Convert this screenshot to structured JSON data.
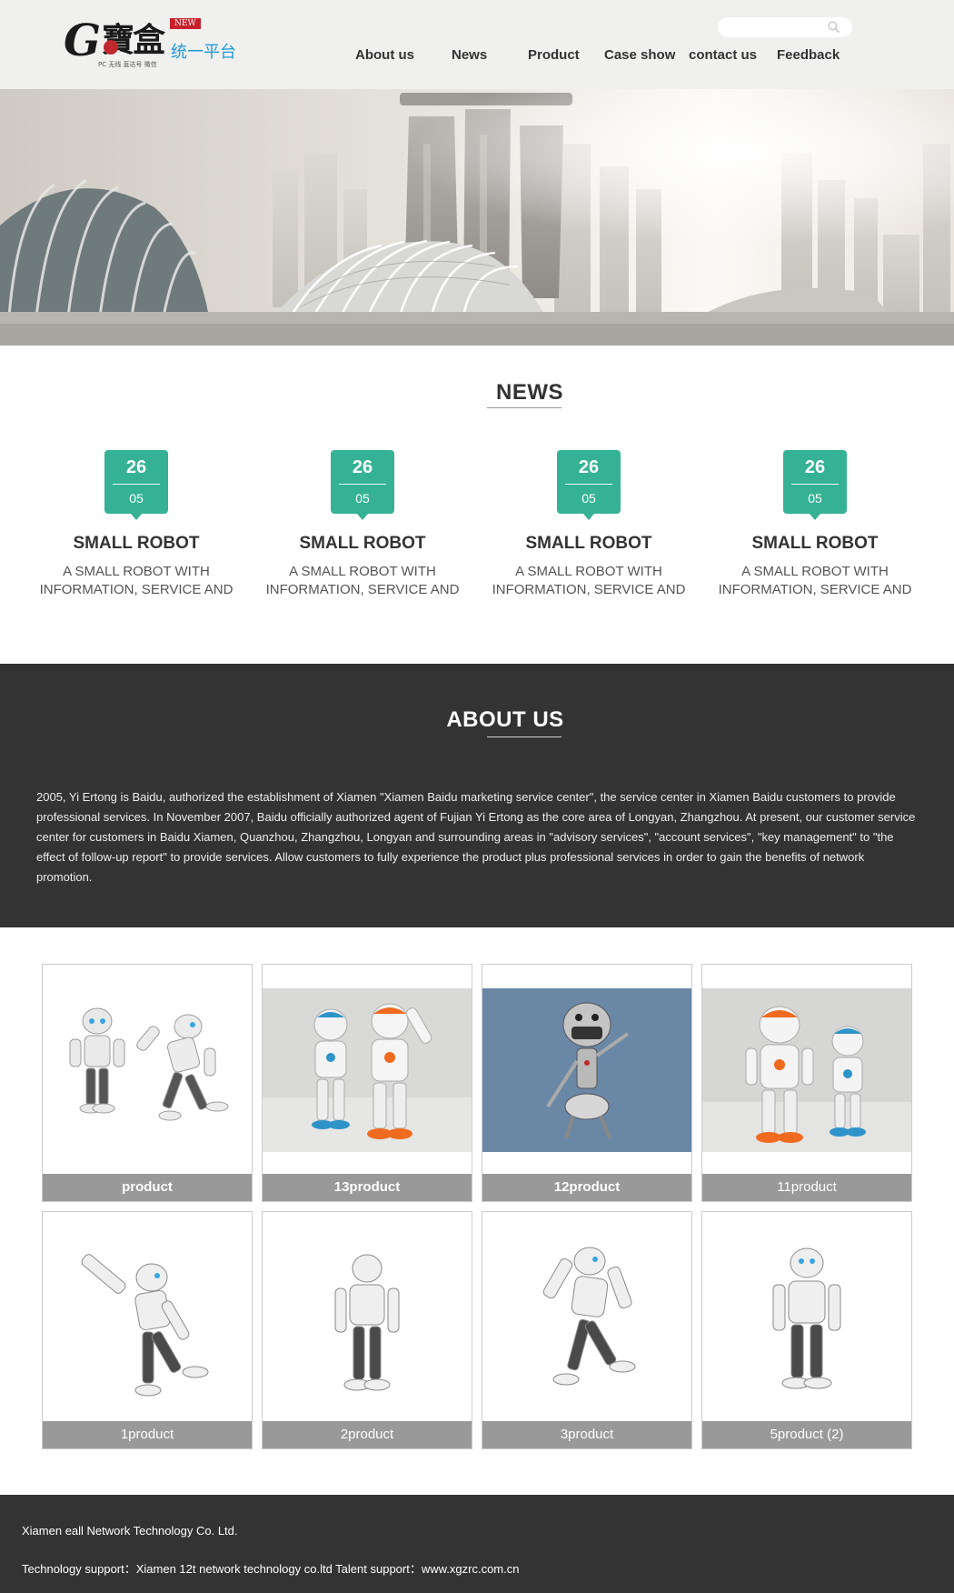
{
  "header": {
    "logo": {
      "g_letter": "G",
      "chinese_name": "寶盒",
      "badge": "NEW",
      "subtitle": "统一平台",
      "tagline": "PC 无线 直达号 微信"
    },
    "search": {
      "value": "",
      "placeholder": "",
      "icon": "search-icon"
    },
    "nav": [
      {
        "label": "About us"
      },
      {
        "label": "News"
      },
      {
        "label": "Product"
      },
      {
        "label": "Case show"
      },
      {
        "label": "contact us"
      },
      {
        "label": "Feedback"
      }
    ]
  },
  "hero": {
    "description": "city skyline banner with domed glass structures"
  },
  "news": {
    "title": "NEWS",
    "items": [
      {
        "day": "26",
        "month": "05",
        "headline": "SMALL ROBOT",
        "desc": "A SMALL ROBOT WITH INFORMATION, SERVICE AND"
      },
      {
        "day": "26",
        "month": "05",
        "headline": "SMALL ROBOT",
        "desc": "A SMALL ROBOT WITH INFORMATION, SERVICE AND"
      },
      {
        "day": "26",
        "month": "05",
        "headline": "SMALL ROBOT",
        "desc": "A SMALL ROBOT WITH INFORMATION, SERVICE AND"
      },
      {
        "day": "26",
        "month": "05",
        "headline": "SMALL ROBOT",
        "desc": "A SMALL ROBOT WITH INFORMATION, SERVICE AND"
      }
    ]
  },
  "about": {
    "title": "ABOUT US",
    "text": "2005, Yi Ertong is Baidu, authorized the establishment of Xiamen \"Xiamen Baidu marketing service center\", the service center in Xiamen Baidu customers to provide professional services. In November 2007, Baidu officially authorized agent of Fujian Yi Ertong as the core area of Longyan, Zhangzhou. At present, our customer service center for customers in Baidu Xiamen, Quanzhou, Zhangzhou, Longyan and surrounding areas in \"advisory services\", \"account services\", \"key management\" to \"the effect of follow-up report\" to provide services. Allow customers to fully experience the product plus professional services in order to gain the benefits of network promotion."
  },
  "products": [
    {
      "label": "product"
    },
    {
      "label": "13product"
    },
    {
      "label": "12product"
    },
    {
      "label": "11product"
    },
    {
      "label": "1product"
    },
    {
      "label": "2product"
    },
    {
      "label": "3product"
    },
    {
      "label": "5product (2)"
    }
  ],
  "footer": {
    "company": "Xiamen eall Network Technology Co. Ltd.",
    "support": "Technology support：Xiamen 12t network technology co.ltd Talent support：www.xgzrc.com.cn"
  },
  "colors": {
    "accent": "#35b296",
    "dark_band": "#333333",
    "header_bg": "#f0f0ef",
    "product_label_bg": "#999999",
    "logo_blue": "#1f9ad6",
    "logo_red": "#c8202a"
  }
}
